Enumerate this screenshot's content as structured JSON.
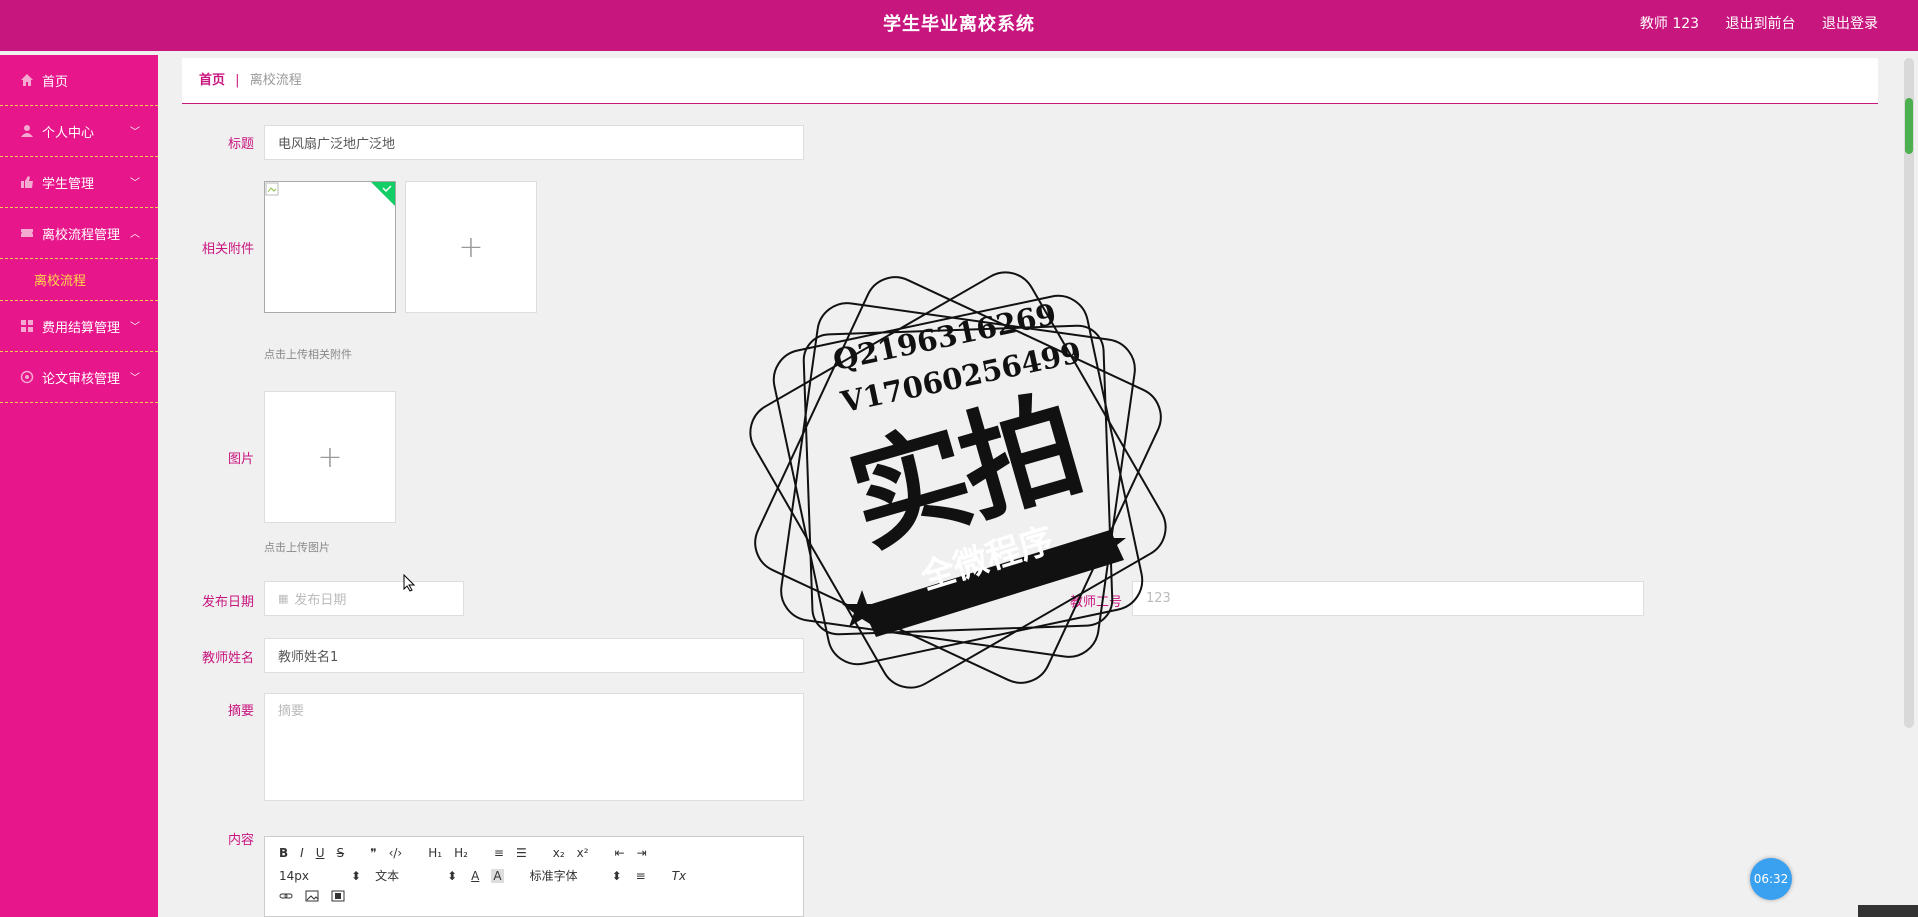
{
  "header": {
    "title": "学生毕业离校系统",
    "user": "教师 123",
    "to_front": "退出到前台",
    "logout": "退出登录"
  },
  "sidebar": {
    "items": [
      {
        "label": "首页",
        "icon": "home-icon"
      },
      {
        "label": "个人中心",
        "icon": "user-icon"
      },
      {
        "label": "学生管理",
        "icon": "thumb-icon"
      },
      {
        "label": "离校流程管理",
        "icon": "ticket-icon"
      },
      {
        "label": "费用结算管理",
        "icon": "grid-icon"
      },
      {
        "label": "论文审核管理",
        "icon": "aperture-icon"
      }
    ],
    "sub_item": "离校流程"
  },
  "breadcrumb": {
    "home": "首页",
    "sep": "|",
    "current": "离校流程"
  },
  "form": {
    "title_label": "标题",
    "title_value": "电风扇广泛地广泛地",
    "attachment_label": "相关附件",
    "attachment_hint": "点击上传相关附件",
    "image_label": "图片",
    "image_hint": "点击上传图片",
    "date_label": "发布日期",
    "date_placeholder": "发布日期",
    "teacher_no_label": "教师工号",
    "teacher_no_value": "123",
    "teacher_name_label": "教师姓名",
    "teacher_name_value": "教师姓名1",
    "summary_label": "摘要",
    "summary_placeholder": "摘要",
    "content_label": "内容"
  },
  "editor": {
    "row1": [
      "B",
      "I",
      "U",
      "S",
      "❞",
      "‹/›",
      "H₁",
      "H₂",
      "≡",
      "☰",
      "x₂",
      "x²",
      "⇤",
      "⇥"
    ],
    "font_size": "14px",
    "header_select": "文本",
    "font_family": "标准字体",
    "row2_tools": [
      "A",
      "A",
      "≡",
      "Tx"
    ]
  },
  "stamp": {
    "line1": "Q2196316269",
    "line2": "V17060256499",
    "big": "实拍",
    "ribbon": "全微程序"
  },
  "timer": "06:32",
  "colors": {
    "brand": "#c8167f",
    "sidebar": "#e8168b",
    "accent": "#f6c84f"
  }
}
